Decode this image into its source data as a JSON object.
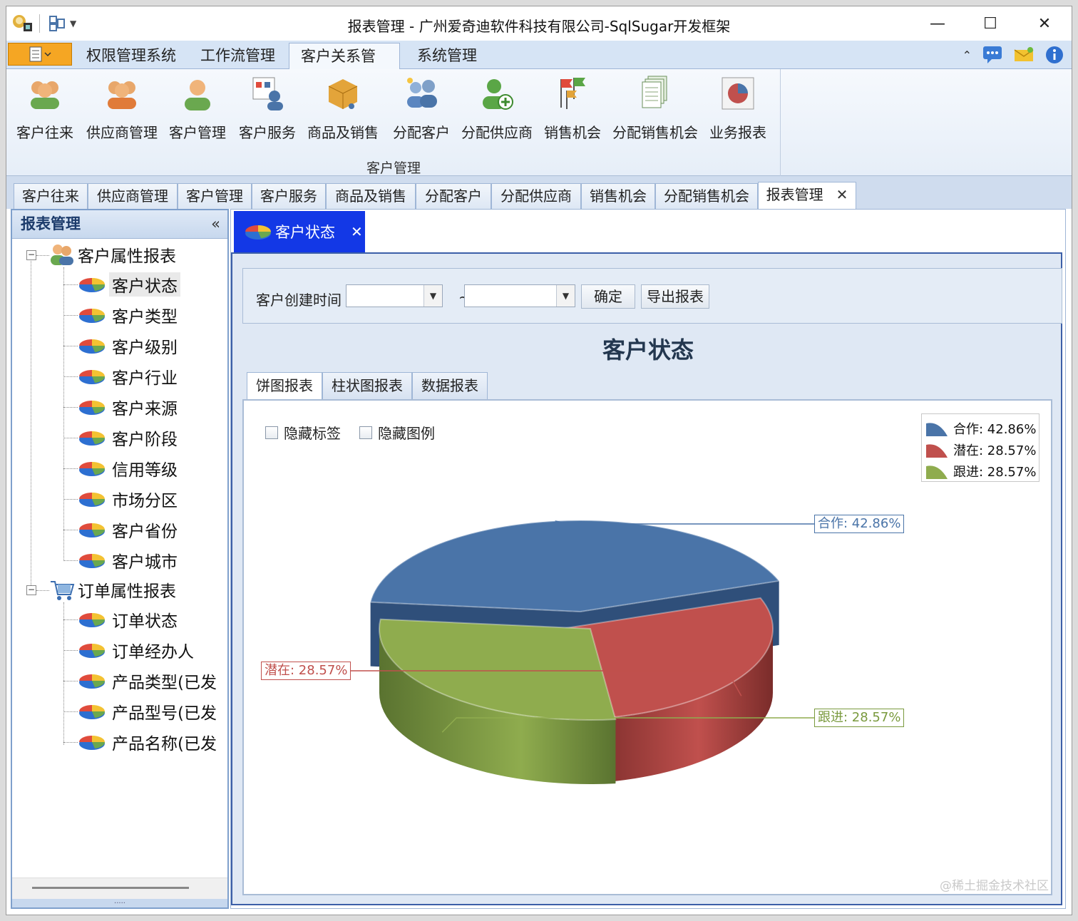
{
  "window": {
    "title": "报表管理 - 广州爱奇迪软件科技有限公司-SqlSugar开发框架"
  },
  "ribbon": {
    "tabs": [
      "权限管理系统",
      "工作流管理",
      "客户关系管理",
      "系统管理"
    ],
    "active_tab": "客户关系管理",
    "group_label": "客户管理",
    "buttons": [
      "客户往来",
      "供应商管理",
      "客户管理",
      "客户服务",
      "商品及销售",
      "分配客户",
      "分配供应商",
      "销售机会",
      "分配销售机会",
      "业务报表"
    ]
  },
  "doc_tabs": [
    "客户往来",
    "供应商管理",
    "客户管理",
    "客户服务",
    "商品及销售",
    "分配客户",
    "分配供应商",
    "销售机会",
    "分配销售机会",
    "报表管理"
  ],
  "doc_tabs_close": "✕",
  "left_panel": {
    "title": "报表管理",
    "collapse": "«",
    "group1": "客户属性报表",
    "group1_items": [
      "客户状态",
      "客户类型",
      "客户级别",
      "客户行业",
      "客户来源",
      "客户阶段",
      "信用等级",
      "市场分区",
      "客户省份",
      "客户城市"
    ],
    "group2": "订单属性报表",
    "group2_items": [
      "订单状态",
      "订单经办人",
      "产品类型(已发",
      "产品型号(已发",
      "产品名称(已发"
    ]
  },
  "content": {
    "tab_label": "客户状态",
    "tab_close": "✕",
    "filter_label": "客户创建时间",
    "date_from": "",
    "date_to": "",
    "tilde": "~",
    "confirm": "确定",
    "export": "导出报表",
    "report_title": "客户状态",
    "report_tabs": [
      "饼图报表",
      "柱状图报表",
      "数据报表"
    ],
    "active_report_tab": "饼图报表",
    "hide_labels": "隐藏标签",
    "hide_legend": "隐藏图例"
  },
  "chart_data": {
    "type": "pie",
    "title": "",
    "categories": [
      "合作",
      "潜在",
      "跟进"
    ],
    "values": [
      42.86,
      28.57,
      28.57
    ],
    "labels": [
      "合作: 42.86%",
      "潜在: 28.57%",
      "跟进: 28.57%"
    ],
    "colors": [
      "#4a74a8",
      "#c0504d",
      "#8fac4e"
    ],
    "legend_position": "top-right",
    "style": "3d-exploded"
  },
  "watermark": "@稀土掘金技术社区"
}
